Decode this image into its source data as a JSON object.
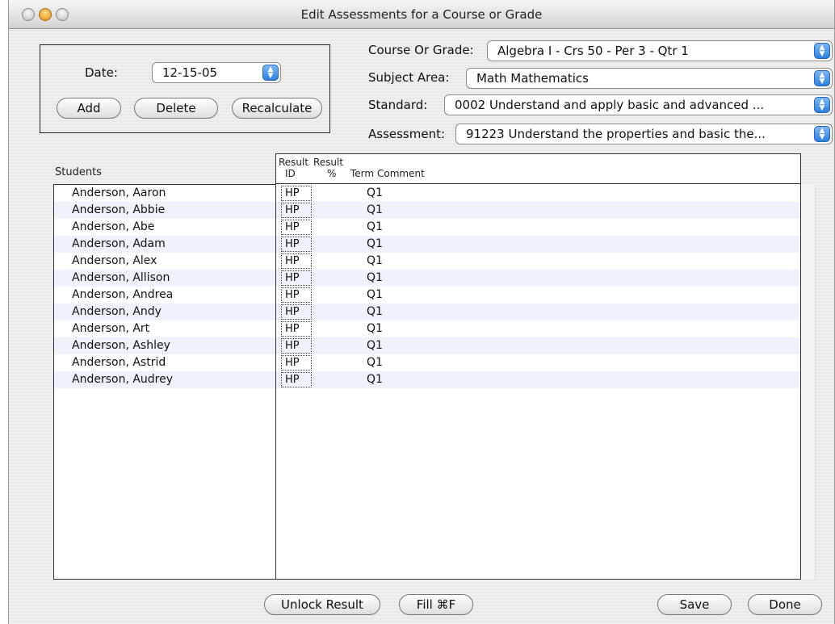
{
  "window": {
    "title": "Edit Assessments for a Course or Grade"
  },
  "date_panel": {
    "date_label": "Date:",
    "date_value": "12-15-05",
    "add_label": "Add",
    "delete_label": "Delete",
    "recalculate_label": "Recalculate"
  },
  "filters": {
    "course_label": "Course Or Grade:",
    "course_value": "Algebra I - Crs 50 - Per 3 - Qtr 1",
    "subject_label": "Subject Area:",
    "subject_value": "Math Mathematics",
    "standard_label": "Standard:",
    "standard_value": "0002 Understand and apply basic and advanced ...",
    "assessment_label": "Assessment:",
    "assessment_value": "91223 Understand the properties and basic the..."
  },
  "table": {
    "students_header": "Students",
    "result_id_header_1": "Result",
    "result_id_header_2": "ID",
    "result_pct_header_1": "Result",
    "result_pct_header_2": "%",
    "term_header": "Term",
    "comment_header": "Comment",
    "rows": [
      {
        "student": "Anderson, Aaron",
        "result_id": "HP",
        "term": "Q1"
      },
      {
        "student": "Anderson, Abbie",
        "result_id": "HP",
        "term": "Q1"
      },
      {
        "student": "Anderson, Abe",
        "result_id": "HP",
        "term": "Q1"
      },
      {
        "student": "Anderson, Adam",
        "result_id": "HP",
        "term": "Q1"
      },
      {
        "student": "Anderson, Alex",
        "result_id": "HP",
        "term": "Q1"
      },
      {
        "student": "Anderson, Allison",
        "result_id": "HP",
        "term": "Q1"
      },
      {
        "student": "Anderson, Andrea",
        "result_id": "HP",
        "term": "Q1"
      },
      {
        "student": "Anderson, Andy",
        "result_id": "HP",
        "term": "Q1"
      },
      {
        "student": "Anderson, Art",
        "result_id": "HP",
        "term": "Q1"
      },
      {
        "student": "Anderson, Ashley",
        "result_id": "HP",
        "term": "Q1"
      },
      {
        "student": "Anderson, Astrid",
        "result_id": "HP",
        "term": "Q1"
      },
      {
        "student": "Anderson, Audrey",
        "result_id": "HP",
        "term": "Q1"
      }
    ]
  },
  "footer": {
    "unlock_label": "Unlock Result",
    "fill_label": "Fill ⌘F",
    "save_label": "Save",
    "done_label": "Done"
  },
  "colors": {
    "row_alt": "#eef2fb",
    "popup_arrow": "#2d7fe0"
  }
}
